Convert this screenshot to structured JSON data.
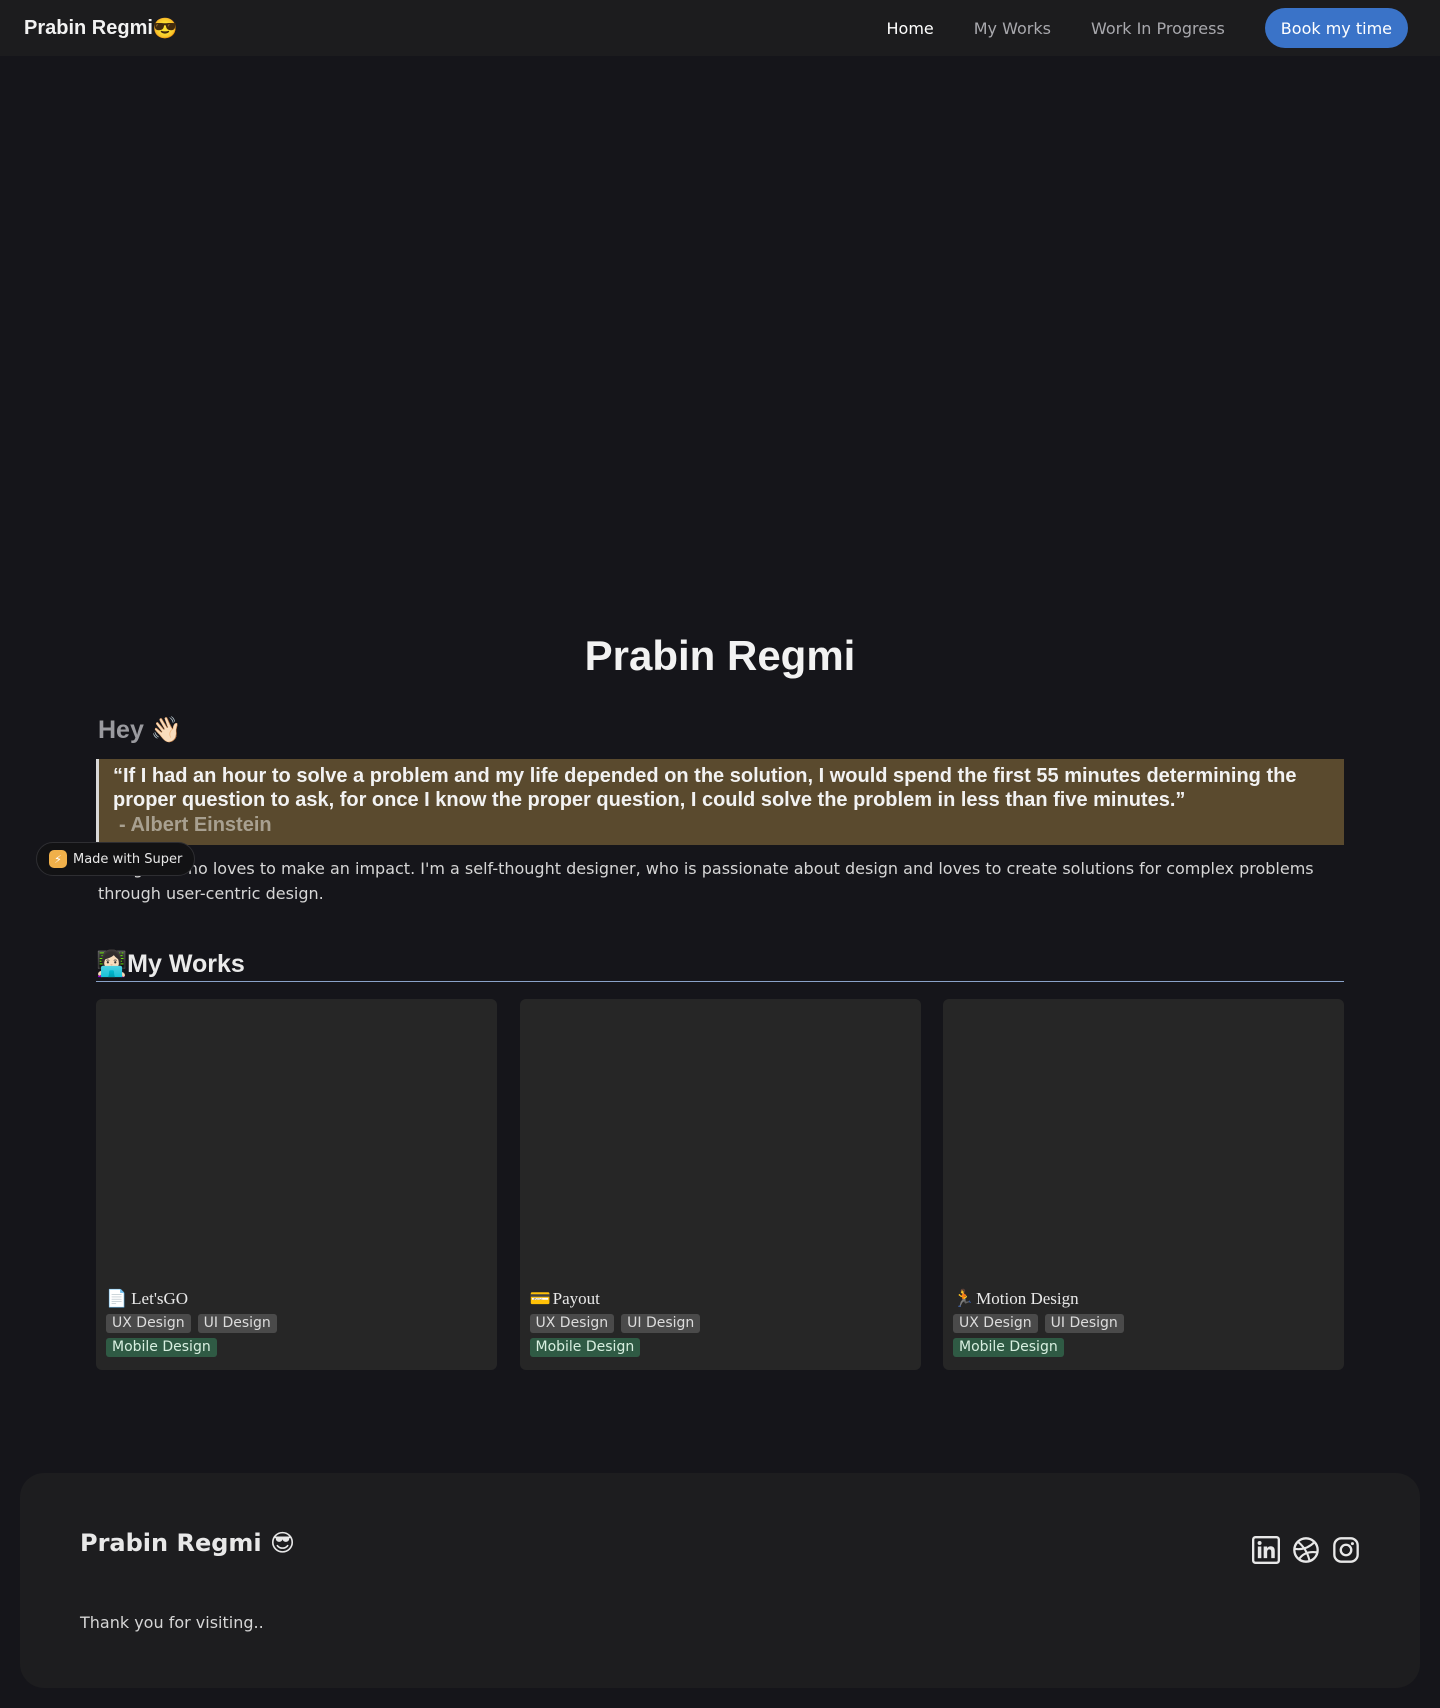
{
  "nav": {
    "brand": "Prabin Regmi",
    "brand_emoji": "😎",
    "links": [
      "Home",
      "My Works",
      "Work In Progress"
    ],
    "cta": "Book my time"
  },
  "hero": {
    "title": "Prabin Regmi",
    "hey": "Hey",
    "hey_emoji": "👋🏻",
    "quote": "“If I had an hour to solve a problem and my life depended on the solution, I would spend the first 55 minutes determining the proper question to ask, for once I know the proper question, I could solve the problem in less than five minutes.”",
    "quote_author": "- Albert Einstein",
    "intro": "Designer who loves to make an impact. I'm a self-thought designer, who is passionate about design and loves to create solutions for complex problems through user-centric design.",
    "badge": "Made with Super"
  },
  "works": {
    "heading": "My Works",
    "heading_emoji": "👩🏻‍💻",
    "cards": [
      {
        "title": "Let'sGO",
        "icon": "📄",
        "tags": [
          "UX Design",
          "UI Design"
        ],
        "tag_green": "Mobile Design"
      },
      {
        "title": "Payout",
        "icon": "💳",
        "tags": [
          "UX Design",
          "UI Design"
        ],
        "tag_green": "Mobile Design"
      },
      {
        "title": "Motion Design",
        "icon": "🏃",
        "tags": [
          "UX Design",
          "UI Design"
        ],
        "tag_green": "Mobile Design"
      }
    ]
  },
  "footer": {
    "name": "Prabin Regmi 😎",
    "thanks": "Thank you for visiting..",
    "socials": [
      "linkedin-icon",
      "dribbble-icon",
      "instagram-icon"
    ]
  },
  "colors": {
    "background": "#15151a",
    "nav_bg": "#1c1c1e",
    "accent": "#3a73c8",
    "quote_bg": "#5a4a2e",
    "tag_gray": "#4a4a4a",
    "tag_green": "#2f5a44"
  }
}
